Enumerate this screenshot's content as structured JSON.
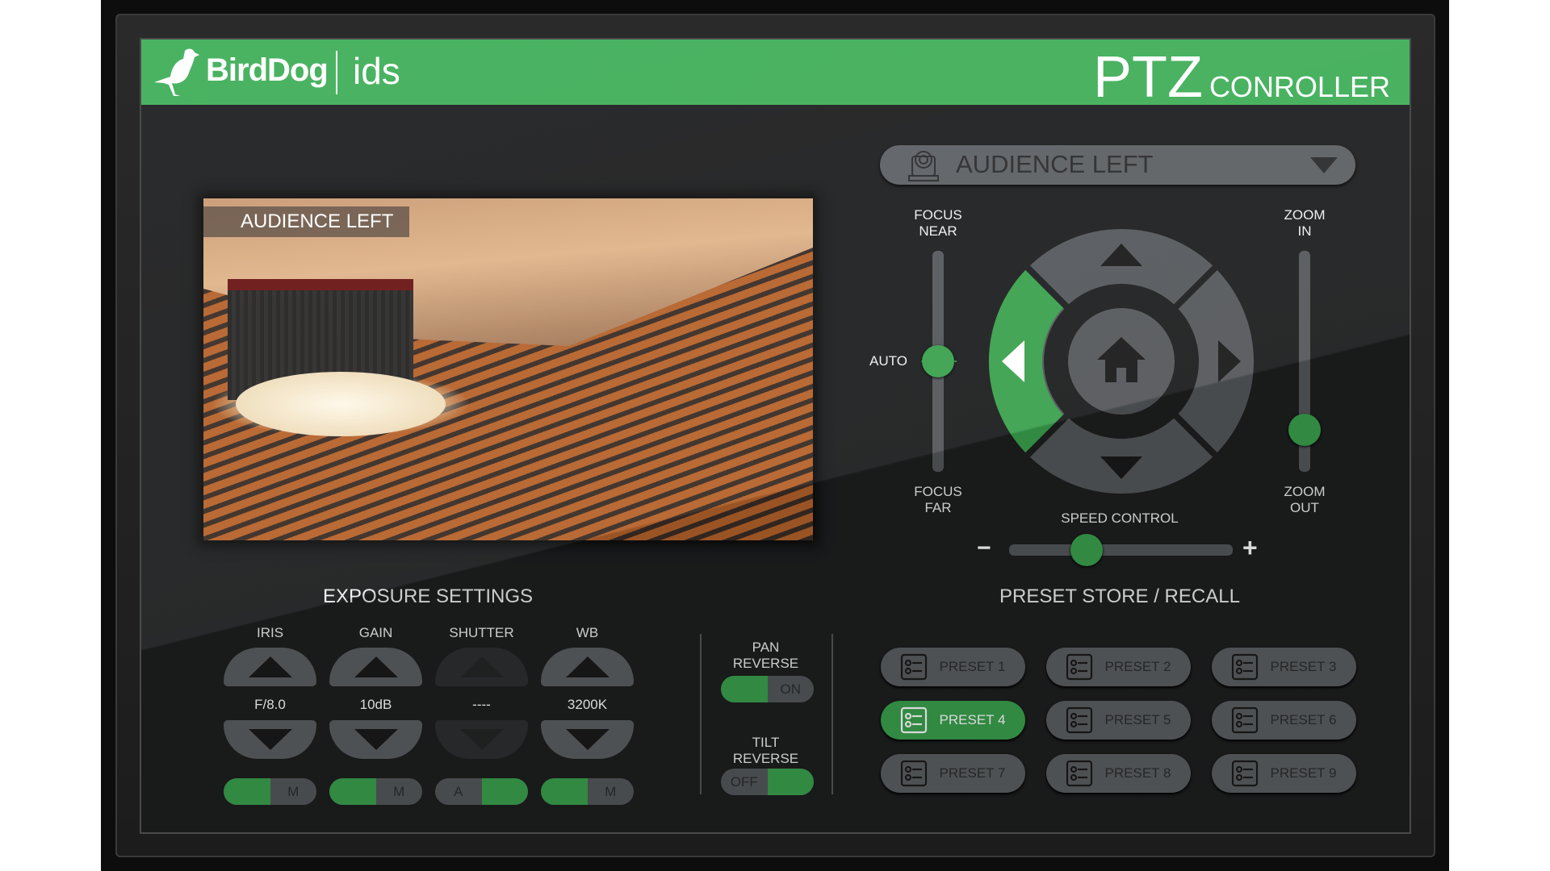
{
  "header": {
    "brand": "BirdDog",
    "partner": "ids",
    "title_main": "PTZ",
    "title_sub": "CONROLLER",
    "accent": "#3fae58"
  },
  "camera_select": {
    "selected": "AUDIENCE LEFT",
    "icon": "ptz-camera-icon"
  },
  "video": {
    "overlay_label": "AUDIENCE LEFT"
  },
  "focus": {
    "near_line1": "FOCUS",
    "near_line2": "NEAR",
    "far_line1": "FOCUS",
    "far_line2": "FAR",
    "auto_label": "AUTO",
    "position_percent": 50
  },
  "zoom": {
    "in_line1": "ZOOM",
    "in_line2": "IN",
    "out_line1": "ZOOM",
    "out_line2": "OUT",
    "position_percent": 80
  },
  "joystick": {
    "active_direction": "left",
    "center_icon": "home-icon"
  },
  "speed": {
    "label": "SPEED CONTROL",
    "minus": "−",
    "plus": "+",
    "value_percent": 35
  },
  "exposure": {
    "title": "EXPOSURE SETTINGS",
    "columns": [
      {
        "label": "IRIS",
        "value": "F/8.0",
        "left": "",
        "right": "M",
        "active": "left",
        "disabled": false
      },
      {
        "label": "GAIN",
        "value": "10dB",
        "left": "",
        "right": "M",
        "active": "left",
        "disabled": false
      },
      {
        "label": "SHUTTER",
        "value": "----",
        "left": "A",
        "right": "",
        "active": "right",
        "disabled": true
      },
      {
        "label": "WB",
        "value": "3200K",
        "left": "",
        "right": "M",
        "active": "left",
        "disabled": false
      }
    ]
  },
  "pan_reverse": {
    "line1": "PAN",
    "line2": "REVERSE",
    "left": "",
    "right": "ON",
    "active": "left"
  },
  "tilt_reverse": {
    "line1": "TILT",
    "line2": "REVERSE",
    "left": "OFF",
    "right": "",
    "active": "right"
  },
  "presets": {
    "title": "PRESET STORE / RECALL",
    "items": [
      {
        "label": "PRESET 1"
      },
      {
        "label": "PRESET 2"
      },
      {
        "label": "PRESET 3"
      },
      {
        "label": "PRESET 4",
        "active": true
      },
      {
        "label": "PRESET 5"
      },
      {
        "label": "PRESET 6"
      },
      {
        "label": "PRESET 7"
      },
      {
        "label": "PRESET 8"
      },
      {
        "label": "PRESET 9"
      }
    ]
  }
}
